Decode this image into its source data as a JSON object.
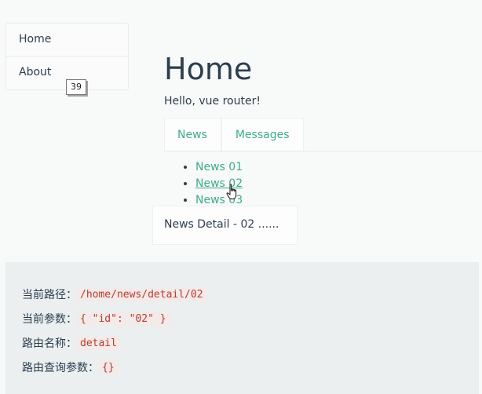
{
  "sidebar": {
    "items": [
      {
        "label": "Home"
      },
      {
        "label": "About"
      }
    ],
    "tooltip": "39"
  },
  "main": {
    "title": "Home",
    "subtitle": "Hello, vue router!",
    "tabs": [
      {
        "label": "News"
      },
      {
        "label": "Messages"
      }
    ],
    "news": [
      {
        "label": "News 01"
      },
      {
        "label": "News 02"
      },
      {
        "label": "News 03"
      }
    ],
    "detail": "News Detail - 02 ......"
  },
  "info": {
    "rows": [
      {
        "label": "当前路径：",
        "value": "/home/news/detail/02"
      },
      {
        "label": "当前参数：",
        "value": "{ \"id\": \"02\" }"
      },
      {
        "label": "路由名称：",
        "value": "detail"
      },
      {
        "label": "路由查询参数：",
        "value": "{}"
      }
    ]
  },
  "colors": {
    "accent": "#3cae84",
    "text": "#2c3e50",
    "code": "#c0392b"
  }
}
